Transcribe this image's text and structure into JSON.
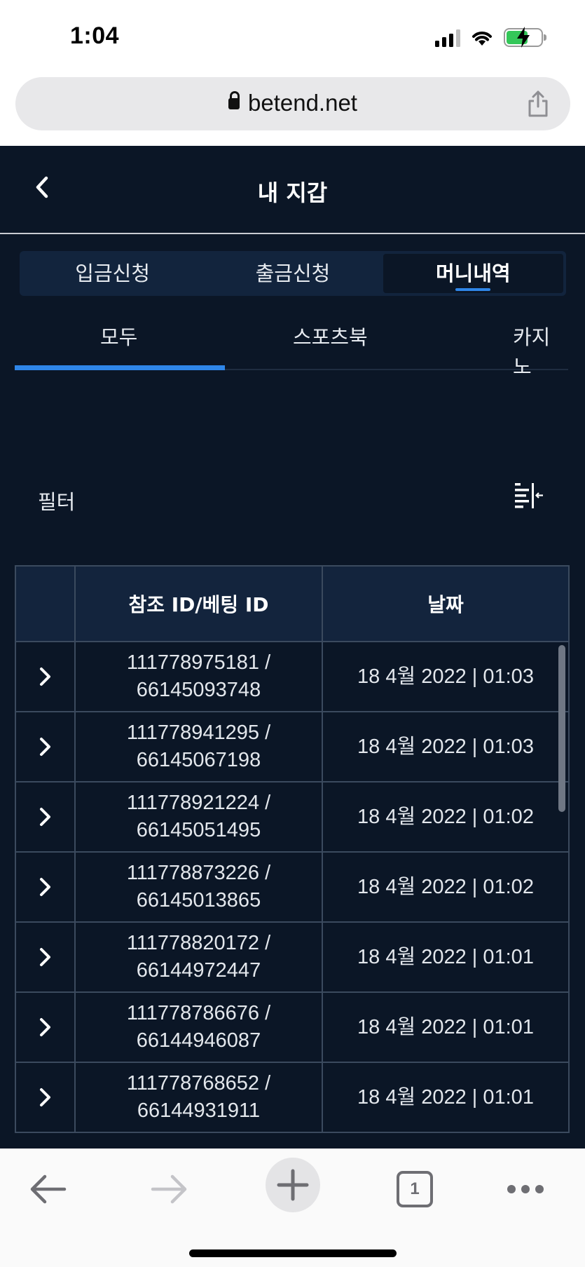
{
  "status_bar": {
    "time": "1:04"
  },
  "browser": {
    "url": "betend.net"
  },
  "header": {
    "title": "내 지갑"
  },
  "wallet_tabs": [
    {
      "label": "입금신청",
      "active": false
    },
    {
      "label": "출금신청",
      "active": false
    },
    {
      "label": "머니내역",
      "active": true
    }
  ],
  "category_tabs": [
    {
      "label": "모두",
      "active": true
    },
    {
      "label": "스포츠북",
      "active": false
    },
    {
      "label": "카지노",
      "active": false
    }
  ],
  "filter": {
    "label": "필터"
  },
  "table": {
    "headers": [
      "참조 ID/베팅 ID",
      "날짜"
    ],
    "rows": [
      {
        "ref_id": "111778975181 /",
        "bet_id": "66145093748",
        "date": "18 4월 2022 | 01:03"
      },
      {
        "ref_id": "111778941295 /",
        "bet_id": "66145067198",
        "date": "18 4월 2022 | 01:03"
      },
      {
        "ref_id": "111778921224 /",
        "bet_id": "66145051495",
        "date": "18 4월 2022 | 01:02"
      },
      {
        "ref_id": "111778873226 /",
        "bet_id": "66145013865",
        "date": "18 4월 2022 | 01:02"
      },
      {
        "ref_id": "111778820172 /",
        "bet_id": "66144972447",
        "date": "18 4월 2022 | 01:01"
      },
      {
        "ref_id": "111778786676 /",
        "bet_id": "66144946087",
        "date": "18 4월 2022 | 01:01"
      },
      {
        "ref_id": "111778768652 /",
        "bet_id": "66144931911",
        "date": "18 4월 2022 | 01:01"
      }
    ]
  },
  "toolbar": {
    "tab_count": "1"
  },
  "colors": {
    "app_bg": "#0b1626",
    "accent": "#2f86e8",
    "header_bg": "#13243d",
    "battery": "#34c759"
  }
}
